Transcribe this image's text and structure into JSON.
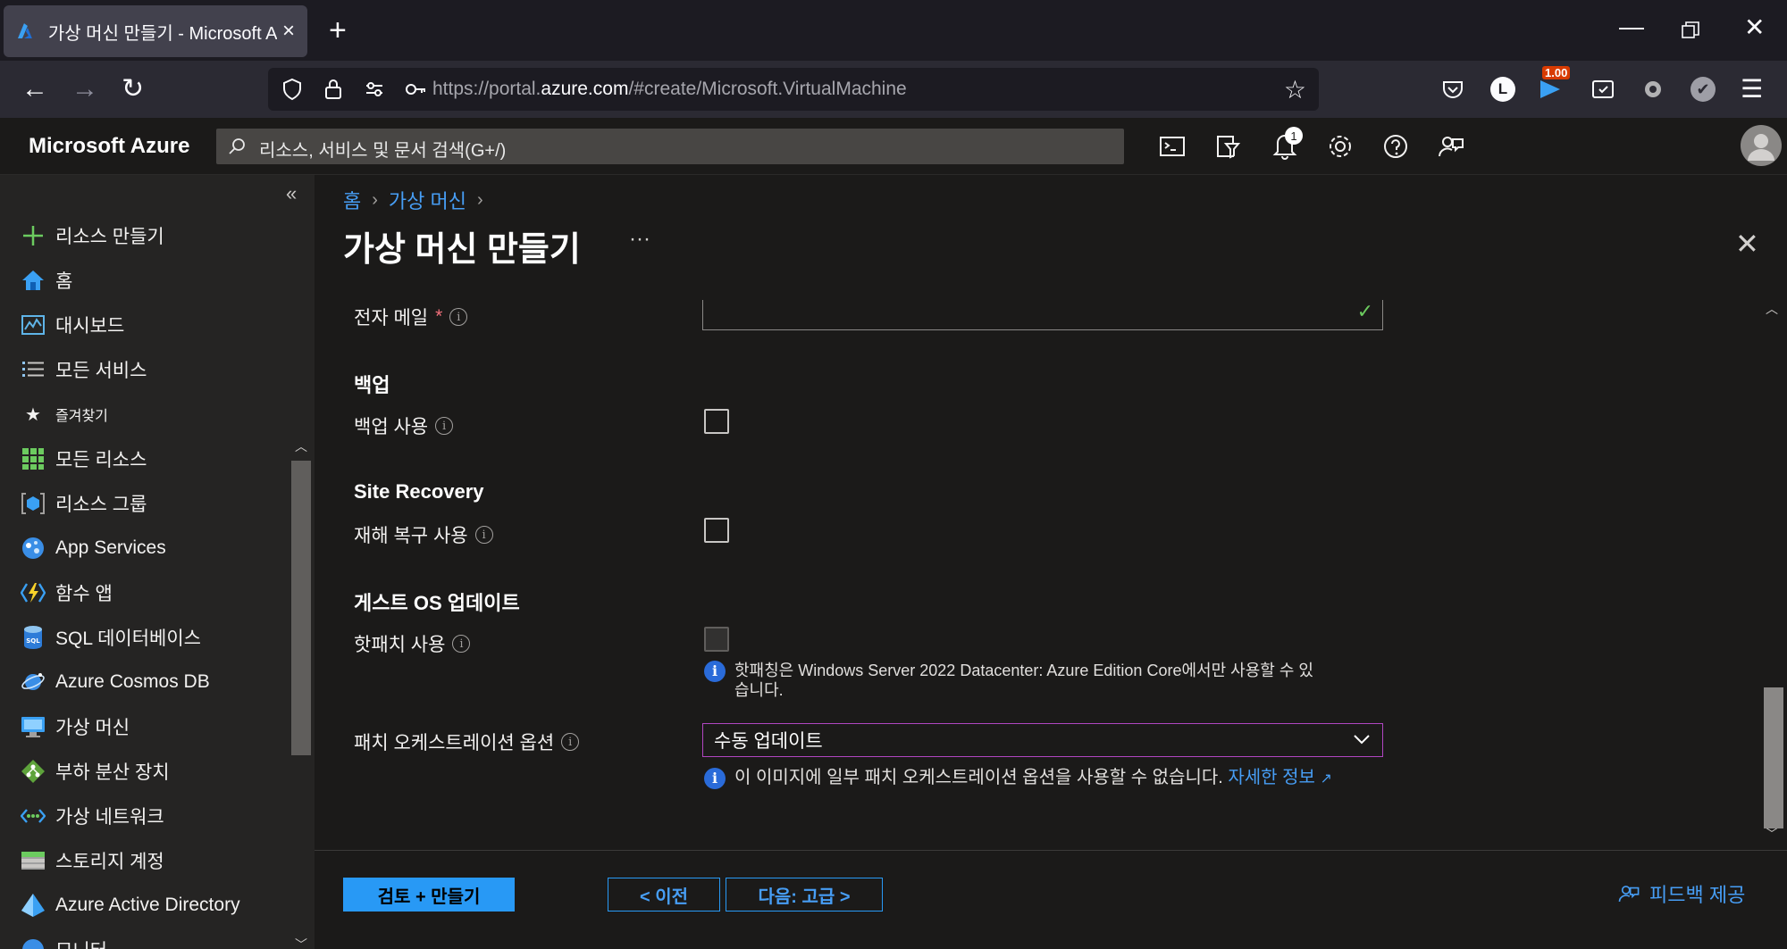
{
  "browser": {
    "tab_title": "가상 머신 만들기 - Microsoft Azure",
    "url_prefix": "https://portal.",
    "url_domain": "azure.com",
    "url_path": "/#create/Microsoft.VirtualMachine",
    "extension_badge": "1.00"
  },
  "azure": {
    "brand": "Microsoft Azure",
    "search_placeholder": "리소스, 서비스 및 문서 검색(G+/)",
    "notification_count": "1"
  },
  "sidebar": {
    "items": [
      {
        "label": "리소스 만들기",
        "icon": "plus-icon"
      },
      {
        "label": "홈",
        "icon": "home-icon"
      },
      {
        "label": "대시보드",
        "icon": "dashboard-icon"
      },
      {
        "label": "모든 서비스",
        "icon": "list-icon"
      },
      {
        "label": "즐겨찾기",
        "icon": "star-icon"
      },
      {
        "label": "모든 리소스",
        "icon": "grid-icon"
      },
      {
        "label": "리소스 그룹",
        "icon": "resource-group-icon"
      },
      {
        "label": "App Services",
        "icon": "app-services-icon"
      },
      {
        "label": "함수 앱",
        "icon": "function-app-icon"
      },
      {
        "label": "SQL 데이터베이스",
        "icon": "sql-database-icon"
      },
      {
        "label": "Azure Cosmos DB",
        "icon": "cosmos-db-icon"
      },
      {
        "label": "가상 머신",
        "icon": "virtual-machine-icon"
      },
      {
        "label": "부하 분산 장치",
        "icon": "load-balancer-icon"
      },
      {
        "label": "가상 네트워크",
        "icon": "virtual-network-icon"
      },
      {
        "label": "스토리지 계정",
        "icon": "storage-account-icon"
      },
      {
        "label": "Azure Active Directory",
        "icon": "active-directory-icon"
      },
      {
        "label": "모니터",
        "icon": "monitor-icon"
      }
    ]
  },
  "main": {
    "breadcrumb": [
      "홈",
      "가상 머신"
    ],
    "title": "가상 머신 만들기",
    "email_label": "전자 메일",
    "required_mark": "*",
    "backup_section": "백업",
    "backup_label": "백업 사용",
    "site_recovery_section": "Site Recovery",
    "disaster_recovery_label": "재해 복구 사용",
    "guest_os_section": "게스트 OS 업데이트",
    "hotpatch_label": "핫패치 사용",
    "hotpatch_note_line1": "핫패칭은 Windows Server 2022 Datacenter: Azure Edition Core에서만 사용할 수 있",
    "hotpatch_note_line2": "습니다.",
    "patch_label": "패치 오케스트레이션 옵션",
    "patch_value": "수동 업데이트",
    "patch_note": "이 이미지에 일부 패치 오케스트레이션 옵션을 사용할 수 없습니다.",
    "patch_note_link": "자세한 정보"
  },
  "footer": {
    "review_create": "검토 + 만들기",
    "previous": "< 이전",
    "next": "다음: 고급 >",
    "feedback": "피드백 제공"
  },
  "colors": {
    "accent": "#2899f5",
    "link": "#479ef5",
    "select_border": "#b146c2",
    "success": "#6ccb5f"
  }
}
